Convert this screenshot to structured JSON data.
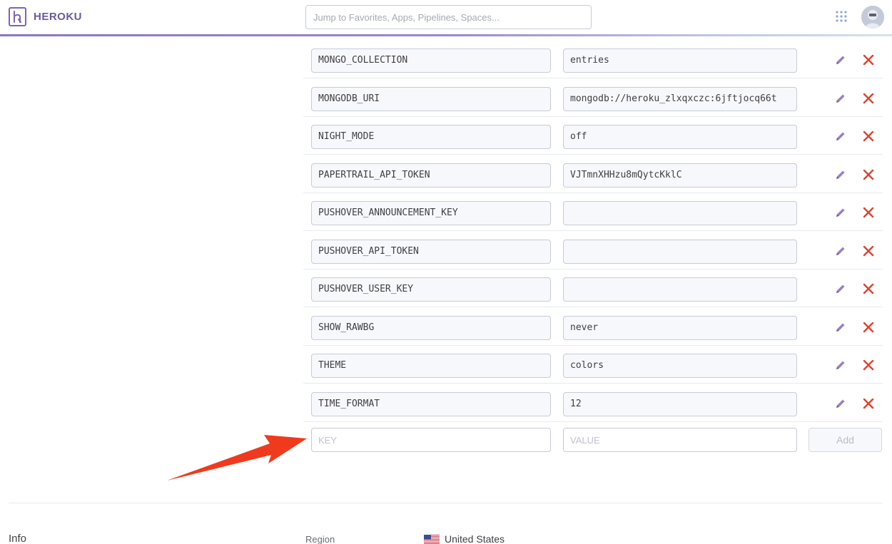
{
  "header": {
    "brand": "HEROKU",
    "search_placeholder": "Jump to Favorites, Apps, Pipelines, Spaces..."
  },
  "config_vars": [
    {
      "key": "MONGO_COLLECTION",
      "value": "entries"
    },
    {
      "key": "MONGODB_URI",
      "value": "mongodb://heroku_zlxqxczc:6jftjocq66t"
    },
    {
      "key": "NIGHT_MODE",
      "value": "off"
    },
    {
      "key": "PAPERTRAIL_API_TOKEN",
      "value": "VJTmnXHHzu8mQytcKklC"
    },
    {
      "key": "PUSHOVER_ANNOUNCEMENT_KEY",
      "value": ""
    },
    {
      "key": "PUSHOVER_API_TOKEN",
      "value": ""
    },
    {
      "key": "PUSHOVER_USER_KEY",
      "value": ""
    },
    {
      "key": "SHOW_RAWBG",
      "value": "never"
    },
    {
      "key": "THEME",
      "value": "colors"
    },
    {
      "key": "TIME_FORMAT",
      "value": "12"
    }
  ],
  "new_var": {
    "key_placeholder": "KEY",
    "value_placeholder": "VALUE",
    "add_label": "Add"
  },
  "info": {
    "section_label": "Info",
    "region_label": "Region",
    "region_value": "United States"
  },
  "colors": {
    "brand": "#6a5a9e",
    "edit_icon": "#9a7fc4",
    "delete_icon": "#e0412f",
    "annotation_arrow": "#f03a1d"
  },
  "icons": [
    "heroku-logo-icon",
    "apps-grid-icon",
    "avatar",
    "pencil-icon",
    "close-icon",
    "us-flag-icon",
    "arrow-annotation"
  ]
}
